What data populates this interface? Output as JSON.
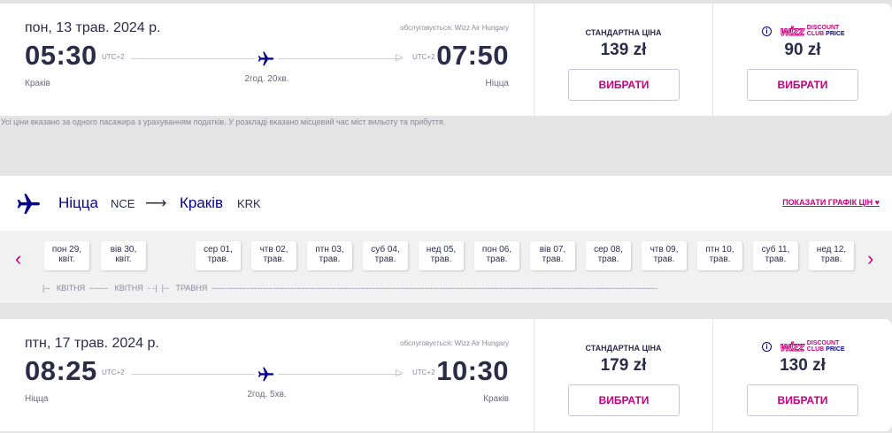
{
  "flight1": {
    "date": "пон, 13 трав. 2024 р.",
    "operated_by": "обслуговується: Wizz Air Hungary",
    "dep_time": "05:30",
    "dep_utc": "UTC+2",
    "arr_time": "07:50",
    "arr_utc": "UTC+2",
    "duration": "2год. 20хв.",
    "dep_city": "Краків",
    "arr_city": "Ніцца",
    "standard_label": "СТАНДАРТНА ЦІНА",
    "standard_price": "139 zł",
    "club_price": "90 zł",
    "select_label": "ВИБРАТИ"
  },
  "wdc_logo": {
    "info": "i",
    "wizz": "wizz",
    "line1": "DISCOUNT",
    "line2a": "CLUB ",
    "line2b": "PRICE"
  },
  "disclaimer": "Усі ціни вказано за одного пасажира з урахуванням податків. У розкладі вказано місцевий час міст вильоту та прибуття.",
  "route": {
    "from_city": "Ніцца",
    "from_code": "NCE",
    "arrow": "⟶",
    "to_city": "Краків",
    "to_code": "KRK",
    "price_chart_link": "ПОКАЗАТИ ГРАФІК ЦІН ♥"
  },
  "date_strip": {
    "prev": "‹",
    "next": "›",
    "dates": [
      {
        "l1": "пон 29,",
        "l2": "квіт."
      },
      {
        "l1": "вів 30,",
        "l2": "квіт."
      },
      {
        "l1": "сер 01,",
        "l2": "трав."
      },
      {
        "l1": "чтв 02,",
        "l2": "трав."
      },
      {
        "l1": "птн 03,",
        "l2": "трав."
      },
      {
        "l1": "суб 04,",
        "l2": "трав."
      },
      {
        "l1": "нед 05,",
        "l2": "трав."
      },
      {
        "l1": "пон 06,",
        "l2": "трав."
      },
      {
        "l1": "вів 07,",
        "l2": "трав."
      },
      {
        "l1": "сер 08,",
        "l2": "трав."
      },
      {
        "l1": "чтв 09,",
        "l2": "трав."
      },
      {
        "l1": "птн 10,",
        "l2": "трав."
      },
      {
        "l1": "суб 11,",
        "l2": "трав."
      },
      {
        "l1": "нед 12,",
        "l2": "трав."
      }
    ],
    "months": "|--   КВІТНЯ  -------   КВІТНЯ  - -|  |--   ТРАВНЯ  ------------------------------------------------------------------------------------------------------------------------------------------------------------------------"
  },
  "flight2": {
    "date": "птн, 17 трав. 2024 р.",
    "operated_by": "обслуговується: Wizz Air Hungary",
    "dep_time": "08:25",
    "dep_utc": "UTC+2",
    "arr_time": "10:30",
    "arr_utc": "UTC+2",
    "duration": "2год. 5хв.",
    "dep_city": "Ніцца",
    "arr_city": "Краків",
    "standard_label": "СТАНДАРТНА ЦІНА",
    "standard_price": "179 zł",
    "club_price": "130 zł",
    "select_label": "ВИБРАТИ"
  },
  "colors": {
    "brand_navy": "#06038d",
    "brand_magenta": "#c6007e"
  },
  "icons": [
    "airplane-icon",
    "info-icon",
    "chevron-left-icon",
    "chevron-right-icon",
    "heart-icon"
  ]
}
